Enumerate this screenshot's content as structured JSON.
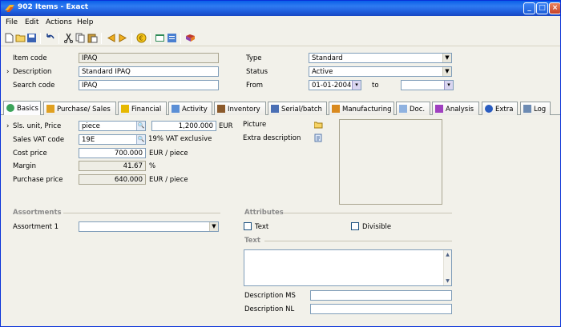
{
  "window": {
    "title": "902 Items - Exact"
  },
  "menu": [
    "File",
    "Edit",
    "Actions",
    "Help"
  ],
  "header": {
    "item_code_label": "Item code",
    "item_code": "IPAQ",
    "description_label": "Description",
    "description": "Standard IPAQ",
    "search_code_label": "Search code",
    "search_code": "IPAQ",
    "type_label": "Type",
    "type": "Standard",
    "status_label": "Status",
    "status": "Active",
    "from_label": "From",
    "from": "01-01-2004",
    "to_label": "to",
    "to": ""
  },
  "tabs": [
    "Basics",
    "Purchase/ Sales",
    "Financial",
    "Activity",
    "Inventory",
    "Serial/batch",
    "Manufacturing",
    "Doc.",
    "Analysis",
    "Extra",
    "Log"
  ],
  "basics": {
    "sls_unit_label": "Sls. unit, Price",
    "sls_unit": "piece",
    "price": "1,200.000",
    "currency": "EUR",
    "vat_label": "Sales VAT code",
    "vat_code": "19E",
    "vat_desc": "19% VAT exclusive",
    "cost_label": "Cost price",
    "cost": "700.000",
    "cost_unit": "EUR / piece",
    "margin_label": "Margin",
    "margin": "41.67",
    "margin_unit": "%",
    "purchase_label": "Purchase price",
    "purchase": "640.000",
    "purchase_unit": "EUR / piece",
    "picture_label": "Picture",
    "extra_desc_label": "Extra description"
  },
  "assortments": {
    "title": "Assortments",
    "assortment1_label": "Assortment 1",
    "assortment1": ""
  },
  "attributes": {
    "title": "Attributes",
    "text_label": "Text",
    "divisible_label": "Divisible"
  },
  "text_section": {
    "title": "Text",
    "desc_ms_label": "Description MS",
    "desc_nl_label": "Description NL"
  },
  "colors": {
    "titlebar": "#0a5fe8",
    "window_bg": "#f2f1ea"
  }
}
